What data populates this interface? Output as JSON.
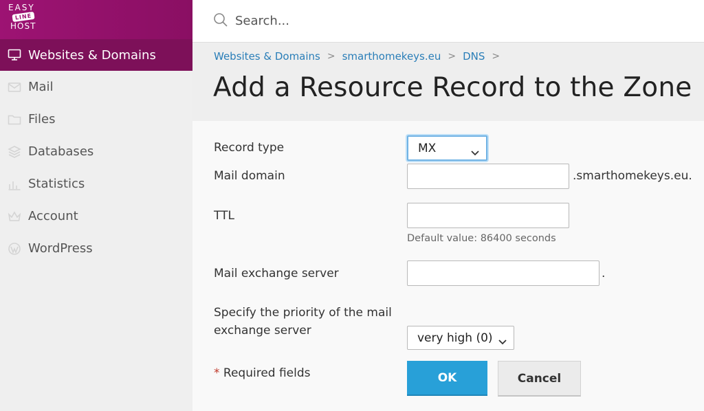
{
  "logo": {
    "line1": "EASY",
    "line2": "LINE",
    "line3": "HOST"
  },
  "search": {
    "placeholder": "Search..."
  },
  "sidebar": {
    "items": [
      {
        "label": "Websites & Domains",
        "icon": "monitor-icon",
        "active": true
      },
      {
        "label": "Mail",
        "icon": "envelope-icon",
        "active": false
      },
      {
        "label": "Files",
        "icon": "folder-icon",
        "active": false
      },
      {
        "label": "Databases",
        "icon": "database-icon",
        "active": false
      },
      {
        "label": "Statistics",
        "icon": "bar-chart-icon",
        "active": false
      },
      {
        "label": "Account",
        "icon": "crown-icon",
        "active": false
      },
      {
        "label": "WordPress",
        "icon": "wordpress-icon",
        "active": false
      }
    ]
  },
  "breadcrumb": {
    "items": [
      "Websites & Domains",
      "smarthomekeys.eu",
      "DNS"
    ],
    "separator": ">"
  },
  "page": {
    "title": "Add a Resource Record to the Zone"
  },
  "form": {
    "record_type": {
      "label": "Record type",
      "value": "MX"
    },
    "mail_domain": {
      "label": "Mail domain",
      "value": "",
      "suffix": ".smarthomekeys.eu."
    },
    "ttl": {
      "label": "TTL",
      "value": "",
      "hint": "Default value: 86400 seconds"
    },
    "mail_exchange_server": {
      "label": "Mail exchange server",
      "value": "",
      "suffix": "."
    },
    "priority": {
      "label_line1": "Specify the priority of the mail",
      "label_line2": "exchange server",
      "value": "very high (0)"
    },
    "required_note": {
      "star": "*",
      "text": " Required fields"
    },
    "ok_label": "OK",
    "cancel_label": "Cancel"
  },
  "colors": {
    "brand": "#9d1373",
    "active_nav": "#7d1059",
    "link": "#2a7eb8",
    "primary_button": "#28a0d8"
  }
}
